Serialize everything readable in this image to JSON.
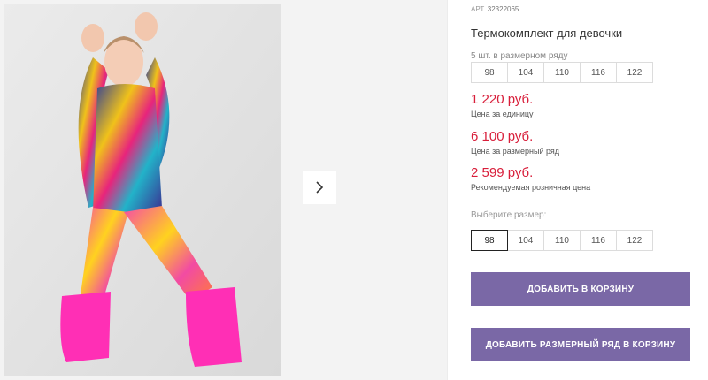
{
  "product": {
    "article_label": "АРТ.",
    "article_code": "32322065",
    "title": "Термокомплект для девочки"
  },
  "size_row": {
    "caption": "5 шт. в размерном ряду",
    "sizes": [
      "98",
      "104",
      "110",
      "116",
      "122"
    ]
  },
  "prices": [
    {
      "value": "1 220 руб.",
      "note": "Цена за единицу"
    },
    {
      "value": "6 100 руб.",
      "note": "Цена за размерный ряд"
    },
    {
      "value": "2 599 руб.",
      "note": "Рекомендуемая розничная цена"
    }
  ],
  "size_select": {
    "label": "Выберите размер:",
    "sizes": [
      "98",
      "104",
      "110",
      "116",
      "122"
    ],
    "selected": "98"
  },
  "buttons": {
    "add_to_cart": "ДОБАВИТЬ В КОРЗИНУ",
    "add_row_to_cart": "ДОБАВИТЬ РАЗМЕРНЫЙ РЯД В КОРЗИНУ"
  },
  "colors": {
    "price": "#d81e3a",
    "button": "#7a68a6"
  },
  "icons": {
    "next": "chevron-right-icon"
  }
}
